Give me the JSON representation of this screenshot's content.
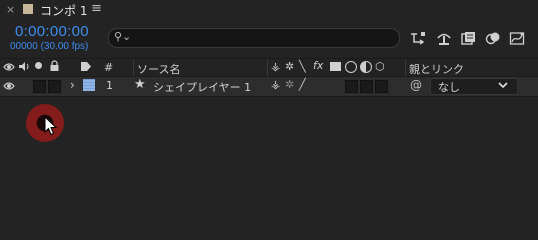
{
  "tab": {
    "close": "×",
    "title": "コンポ 1",
    "menu": "≡"
  },
  "time": {
    "current": "0:00:00:00",
    "frames": "00000 (30.00 fps)"
  },
  "search": {
    "placeholder": ""
  },
  "columns": {
    "number": "#",
    "source_name": "ソース名",
    "parent_link": "親とリンク"
  },
  "layer": {
    "index": "1",
    "name": "シェイプレイヤー 1",
    "parent": "なし"
  },
  "colors": {
    "timecode": "#3f8cf0",
    "label_swatch": "#8fb4e6",
    "tab_swatch": "#c9b79a",
    "click_ring": "#8c1b1b"
  },
  "icons": [
    "close-icon",
    "menu-icon",
    "search-icon",
    "comp-flowchart-icon",
    "draft-3d-icon",
    "frame-blending-icon",
    "motion-blur-icon",
    "graph-editor-icon",
    "eye-icon",
    "audio-icon",
    "solo-icon",
    "lock-icon",
    "label-icon",
    "expand-chevron-icon",
    "star-icon",
    "shy-icon",
    "collapse-icon",
    "quality-icon",
    "fx-icon",
    "pickwhip-icon",
    "dropdown-chevron-icon",
    "mouse-cursor-icon"
  ]
}
